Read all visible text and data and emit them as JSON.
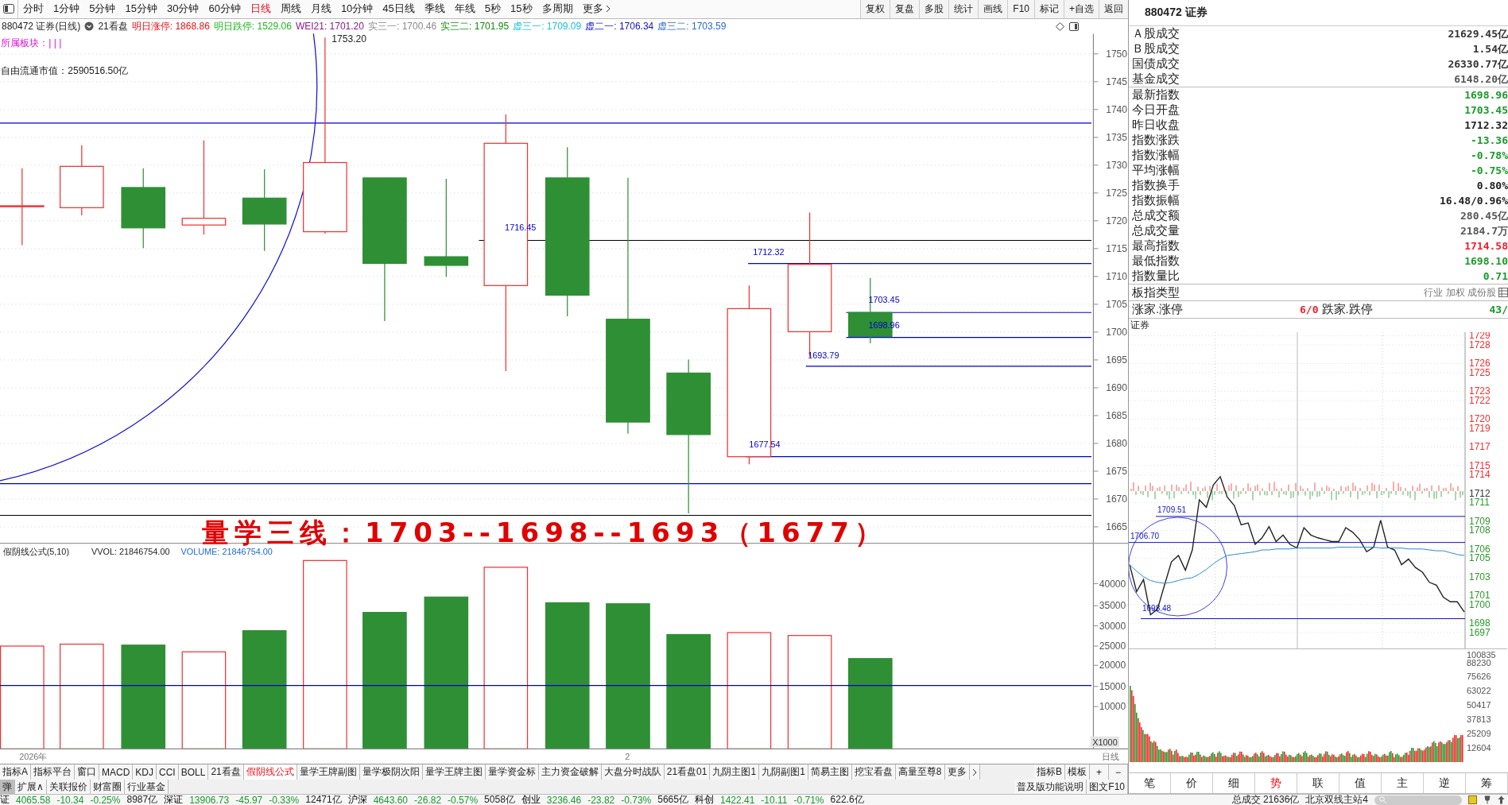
{
  "toolbar": {
    "periods": [
      {
        "label": "分时",
        "selected": false
      },
      {
        "label": "1分钟",
        "selected": false
      },
      {
        "label": "5分钟",
        "selected": false
      },
      {
        "label": "15分钟",
        "selected": false
      },
      {
        "label": "30分钟",
        "selected": false
      },
      {
        "label": "60分钟",
        "selected": false
      },
      {
        "label": "日线",
        "selected": true
      },
      {
        "label": "周线",
        "selected": false
      },
      {
        "label": "月线",
        "selected": false
      },
      {
        "label": "10分钟",
        "selected": false
      },
      {
        "label": "45日线",
        "selected": false
      },
      {
        "label": "季线",
        "selected": false
      },
      {
        "label": "年线",
        "selected": false
      },
      {
        "label": "5秒",
        "selected": false
      },
      {
        "label": "15秒",
        "selected": false
      },
      {
        "label": "多周期",
        "selected": false
      }
    ],
    "more": "更多",
    "actions": [
      "复权",
      "复盘",
      "多股",
      "统计",
      "画线",
      "F10",
      "标记",
      "+自选",
      "返回"
    ]
  },
  "info_line": {
    "title": "880472 证券(日线)",
    "board": "21看盘",
    "indicators": [
      {
        "label": "明日涨停:",
        "value": "1868.86",
        "color": "#e8101a"
      },
      {
        "label": "明日跌停:",
        "value": "1529.06",
        "color": "#1fb81f"
      },
      {
        "label": "WEI21:",
        "value": "1701.20",
        "color": "#8b1a8b"
      },
      {
        "label": "实三一:",
        "value": "1700.46",
        "color": "#8a8a8a"
      },
      {
        "label": "实三二:",
        "value": "1701.95",
        "color": "#108a10"
      },
      {
        "label": "虚三一:",
        "value": "1709.09",
        "color": "#18c0d8"
      },
      {
        "label": "虚二一:",
        "value": "1706.34",
        "color": "#1010c8"
      },
      {
        "label": "虚三二:",
        "value": "1703.59",
        "color": "#2a6ad0"
      }
    ]
  },
  "overlay": {
    "sector_label": "所属板块：",
    "sector_marks": "|  |  |",
    "market_cap": "自由流通市值：2590516.50亿",
    "high_label": "1753.20"
  },
  "price_axis": [
    "1750",
    "1745",
    "1740",
    "1735",
    "1730",
    "1725",
    "1720",
    "1715",
    "1710",
    "1705",
    "1700",
    "1695",
    "1690",
    "1685",
    "1680",
    "1675",
    "1670",
    "1665"
  ],
  "price_lines": [
    "1716.45",
    "1712.32",
    "1703.45",
    "1698.96",
    "1693.79",
    "1677.54"
  ],
  "annotation": "量学三线：1703--1698--1693（1677）",
  "volume_pane": {
    "title": "假阴线公式(5,10)",
    "vvol": "VVOL: 21846754.00",
    "volume": "VOLUME: 21846754.00",
    "axis": [
      "40000",
      "35000",
      "30000",
      "25000",
      "20000",
      "15000",
      "10000"
    ],
    "unit": "X1000"
  },
  "date_axis": [
    "2026年",
    "2",
    "日线"
  ],
  "indicator_tabs": [
    {
      "label": "指标A",
      "selected": false
    },
    {
      "label": "指标平台",
      "selected": false
    },
    {
      "label": "窗口",
      "selected": false
    },
    {
      "label": "MACD",
      "selected": false
    },
    {
      "label": "KDJ",
      "selected": false
    },
    {
      "label": "CCI",
      "selected": false
    },
    {
      "label": "BOLL",
      "selected": false
    },
    {
      "label": "21看盘",
      "selected": false
    },
    {
      "label": "假阴线公式",
      "selected": true
    },
    {
      "label": "量学王牌副图",
      "selected": false
    },
    {
      "label": "量学极阴次阳",
      "selected": false
    },
    {
      "label": "量学王牌主图",
      "selected": false
    },
    {
      "label": "量学资金标",
      "selected": false
    },
    {
      "label": "主力资金破解",
      "selected": false
    },
    {
      "label": "大盘分时战队",
      "selected": false
    },
    {
      "label": "21看盘01",
      "selected": false
    },
    {
      "label": "九阴主图1",
      "selected": false
    },
    {
      "label": "九阴副图1",
      "selected": false
    },
    {
      "label": "简易主图",
      "selected": false
    },
    {
      "label": "挖宝看盘",
      "selected": false
    },
    {
      "label": "高量至尊8",
      "selected": false
    },
    {
      "label": "更多",
      "selected": false
    }
  ],
  "template_tabs": [
    "指标B",
    "模板"
  ],
  "zoom_buttons": [
    "+",
    "−"
  ],
  "sub_tabs": [
    {
      "label": "弹",
      "selected": true
    },
    {
      "label": "扩展∧",
      "selected": false
    },
    {
      "label": "关联报价",
      "selected": false
    },
    {
      "label": "财富圈",
      "selected": false
    },
    {
      "label": "行业基金",
      "selected": false
    }
  ],
  "help_links": [
    "普及版功能说明",
    "图文F10"
  ],
  "quote_panel": {
    "title": "880472 证券",
    "turnover": [
      {
        "label": "Ａ股成交",
        "value": "21629.45亿",
        "color": "#333333"
      },
      {
        "label": "Ｂ股成交",
        "value": "1.54亿",
        "color": "#333333"
      },
      {
        "label": "国债成交",
        "value": "26330.77亿",
        "color": "#333333"
      },
      {
        "label": "基金成交",
        "value": "6148.20亿",
        "color": "#555555"
      }
    ],
    "stats": [
      {
        "label": "最新指数",
        "value": "1698.96",
        "color": "#1a9a2a"
      },
      {
        "label": "今日开盘",
        "value": "1703.45",
        "color": "#1a9a2a"
      },
      {
        "label": "昨日收盘",
        "value": "1712.32",
        "color": "#222222"
      },
      {
        "label": "指数涨跌",
        "value": "-13.36",
        "color": "#1a9a2a"
      },
      {
        "label": "指数涨幅",
        "value": "-0.78%",
        "color": "#1a9a2a"
      },
      {
        "label": "平均涨幅",
        "value": "-0.75%",
        "color": "#1a9a2a"
      },
      {
        "label": "指数换手",
        "value": "0.80%",
        "color": "#222222"
      },
      {
        "label": "指数振幅",
        "value": "16.48/0.96%",
        "color": "#222222"
      },
      {
        "label": "总成交额",
        "value": "280.45亿",
        "color": "#555555"
      },
      {
        "label": "总成交量",
        "value": "2184.7万",
        "color": "#555555"
      },
      {
        "label": "最高指数",
        "value": "1714.58",
        "color": "#f0202a"
      },
      {
        "label": "最低指数",
        "value": "1698.10",
        "color": "#1a9a2a"
      },
      {
        "label": "指数量比",
        "value": "0.71",
        "color": "#1a9a2a"
      }
    ],
    "type_label": "板指类型",
    "type_value": "行业 加权 成份股",
    "breadth": {
      "up_label": "涨家.涨停",
      "up_value": "6/0",
      "down_label": "跌家.跌停",
      "down_value": "43/"
    }
  },
  "intraday": {
    "title": "证券",
    "chart_data": {
      "type": "line",
      "grid": true,
      "categories": [
        null,
        null,
        null,
        null,
        null,
        null,
        null,
        null,
        null,
        null,
        null,
        null,
        null,
        null,
        null,
        null,
        null,
        null,
        null,
        null,
        null,
        null,
        null,
        null,
        null,
        null,
        null,
        null,
        null,
        null,
        null,
        null,
        null,
        null,
        null,
        null,
        null,
        null,
        null,
        null,
        null,
        null,
        null,
        null,
        null,
        null,
        null,
        null,
        null
      ],
      "ylim": [
        1695.27,
        1729.38
      ],
      "yticks": [
        1729,
        1728,
        1726,
        1725,
        1723,
        1722,
        1720,
        1719,
        1717,
        1715,
        1714,
        1712,
        1711,
        1709,
        1708,
        1706,
        1705,
        1703,
        1701,
        1700,
        1698,
        1697
      ],
      "ref_lines": [
        {
          "axis": "y",
          "value": 1709.51,
          "label": "1709.51"
        },
        {
          "axis": "y",
          "value": 1706.7,
          "label": "1706.70"
        },
        {
          "axis": "y",
          "value": 1698.48,
          "label": "1698.48"
        }
      ],
      "series": [
        {
          "color": "#222222",
          "values": [
            1704.3,
            1701.4,
            1702.7,
            1698.9,
            1699.5,
            1702.1,
            1704.6,
            1705.3,
            1703.7,
            1705.9,
            1711.3,
            1710.5,
            1712.9,
            1713.8,
            1711.6,
            1710.7,
            1708.6,
            1708.8,
            1706.5,
            1707.2,
            1708.4,
            1706.8,
            1707.5,
            1706.5,
            1706.1,
            1708.3,
            1707.5,
            1707.2,
            1707.0,
            1706.8,
            1706.8,
            1708.3,
            1707.8,
            1707.0,
            1705.7,
            1706.2,
            1709.1,
            1706.2,
            1705.9,
            1704.3,
            1704.9,
            1704.0,
            1703.5,
            1702.4,
            1702.1,
            1700.8,
            1700.3,
            1700.3,
            1699.2
          ]
        },
        {
          "color": "#2a8ad8",
          "values": [
            1704.3,
            1703.6,
            1703.0,
            1702.6,
            1702.4,
            1702.3,
            1702.4,
            1702.6,
            1702.8,
            1702.9,
            1703.3,
            1703.8,
            1704.4,
            1704.9,
            1705.3,
            1705.4,
            1705.5,
            1705.6,
            1705.7,
            1705.9,
            1705.9,
            1706.0,
            1706.0,
            1706.0,
            1706.1,
            1706.1,
            1706.1,
            1706.1,
            1706.1,
            1706.1,
            1706.2,
            1706.2,
            1706.2,
            1706.2,
            1706.2,
            1706.2,
            1706.1,
            1706.1,
            1706.1,
            1706.1,
            1706.0,
            1706.0,
            1706.0,
            1705.9,
            1705.8,
            1705.8,
            1705.6,
            1705.4,
            1705.3
          ]
        }
      ]
    },
    "volume_axis": [
      "100835",
      "88230",
      "75626",
      "63022",
      "50417",
      "37813",
      "25209",
      "12604"
    ],
    "tabs": [
      {
        "label": "笔",
        "selected": false
      },
      {
        "label": "价",
        "selected": false
      },
      {
        "label": "细",
        "selected": false
      },
      {
        "label": "势",
        "selected": true
      },
      {
        "label": "联",
        "selected": false
      },
      {
        "label": "值",
        "selected": false
      },
      {
        "label": "主",
        "selected": false
      },
      {
        "label": "逆",
        "selected": false
      },
      {
        "label": "筹",
        "selected": false
      }
    ]
  },
  "status_bar": [
    {
      "text": "证",
      "kind": "name"
    },
    {
      "text": "4065.58",
      "kind": "change"
    },
    {
      "text": "-10.34",
      "kind": "change"
    },
    {
      "text": "-0.25%",
      "kind": "change"
    },
    {
      "text": "8987亿",
      "kind": "amount"
    },
    {
      "text": "深证",
      "kind": "name"
    },
    {
      "text": "13906.73",
      "kind": "change"
    },
    {
      "text": "-45.97",
      "kind": "change"
    },
    {
      "text": "-0.33%",
      "kind": "change"
    },
    {
      "text": "12471亿",
      "kind": "amount"
    },
    {
      "text": "沪深",
      "kind": "name"
    },
    {
      "text": "4643.60",
      "kind": "change"
    },
    {
      "text": "-26.82",
      "kind": "change"
    },
    {
      "text": "-0.57%",
      "kind": "change"
    },
    {
      "text": "5058亿",
      "kind": "amount"
    },
    {
      "text": "创业",
      "kind": "name"
    },
    {
      "text": "3236.46",
      "kind": "change"
    },
    {
      "text": "-23.82",
      "kind": "change"
    },
    {
      "text": "-0.73%",
      "kind": "change"
    },
    {
      "text": "5665亿",
      "kind": "amount"
    },
    {
      "text": "科创",
      "kind": "name"
    },
    {
      "text": "1422.41",
      "kind": "change"
    },
    {
      "text": "-10.11",
      "kind": "change"
    },
    {
      "text": "-0.71%",
      "kind": "change"
    },
    {
      "text": "622.6亿",
      "kind": "amount"
    }
  ],
  "status_right": {
    "total": "总成交 21636亿",
    "server": "北京双线主站4"
  }
}
